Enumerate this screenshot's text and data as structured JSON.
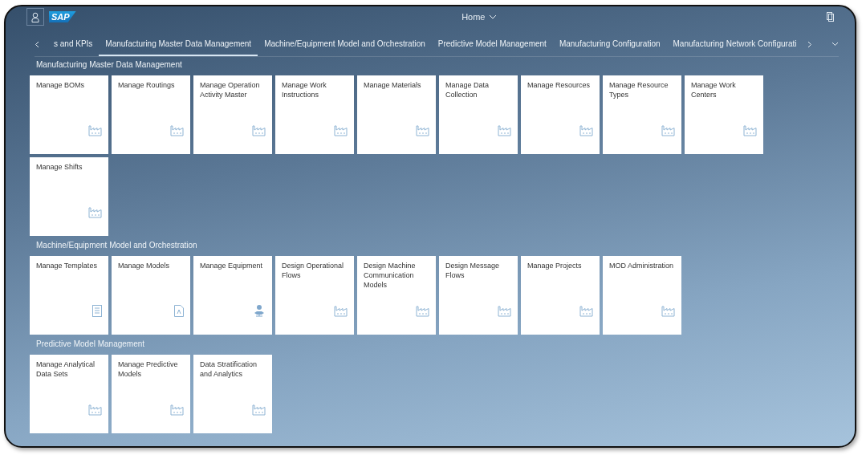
{
  "header": {
    "logo": "SAP",
    "title": "Home"
  },
  "tabs": [
    {
      "label": "s and KPIs",
      "selected": false
    },
    {
      "label": "Manufacturing Master Data Management",
      "selected": true
    },
    {
      "label": "Machine/Equipment Model and Orchestration",
      "selected": false
    },
    {
      "label": "Predictive Model Management",
      "selected": false
    },
    {
      "label": "Manufacturing Configuration",
      "selected": false
    },
    {
      "label": "Manufacturing Network Configurati",
      "selected": false
    }
  ],
  "groups": [
    {
      "title": "Manufacturing Master Data Management",
      "tiles": [
        {
          "title": "Manage BOMs",
          "kind": "factory"
        },
        {
          "title": "Manage Routings",
          "kind": "factory"
        },
        {
          "title": "Manage Operation Activity Master",
          "kind": "factory"
        },
        {
          "title": "Manage Work Instructions",
          "kind": "factory"
        },
        {
          "title": "Manage Materials",
          "kind": "factory"
        },
        {
          "title": "Manage Data Collection",
          "kind": "factory"
        },
        {
          "title": "Manage Resources",
          "kind": "factory"
        },
        {
          "title": "Manage Resource Types",
          "kind": "factory"
        },
        {
          "title": "Manage Work Centers",
          "kind": "factory"
        },
        {
          "title": "Manage Shifts",
          "kind": "factory"
        }
      ]
    },
    {
      "title": "Machine/Equipment Model and Orchestration",
      "tiles": [
        {
          "title": "Manage Templates",
          "kind": "list"
        },
        {
          "title": "Manage Models",
          "kind": "document"
        },
        {
          "title": "Manage Equipment",
          "kind": "person"
        },
        {
          "title": "Design Operational Flows",
          "kind": "factory"
        },
        {
          "title": "Design Machine Communication Models",
          "kind": "factory"
        },
        {
          "title": "Design Message Flows",
          "kind": "factory"
        },
        {
          "title": "Manage Projects",
          "kind": "factory"
        },
        {
          "title": "MOD Administration",
          "kind": "factory"
        }
      ]
    },
    {
      "title": "Predictive Model Management",
      "tiles": [
        {
          "title": "Manage Analytical Data Sets",
          "kind": "factory"
        },
        {
          "title": "Manage Predictive Models",
          "kind": "factory"
        },
        {
          "title": "Data Stratification and Analytics",
          "kind": "factory"
        }
      ]
    }
  ]
}
